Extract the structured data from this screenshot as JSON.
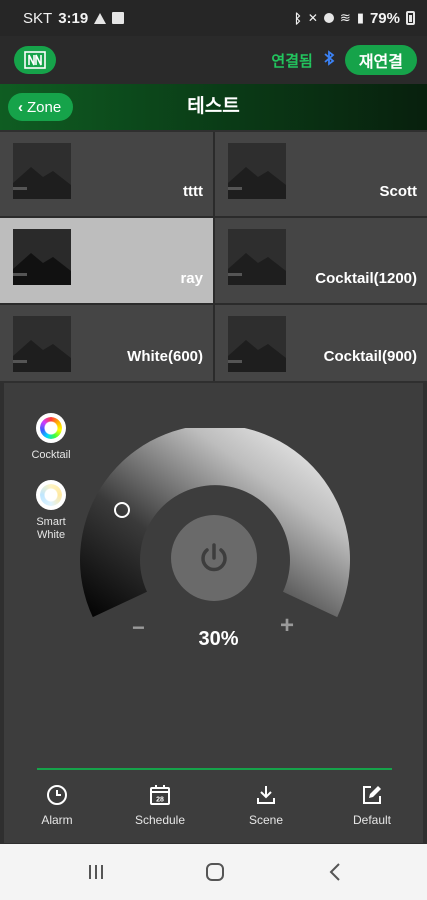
{
  "status_bar": {
    "carrier": "SKT",
    "time": "3:19",
    "battery": "79%"
  },
  "app_bar": {
    "connection_status": "연결됨",
    "bluetooth_icon": "bluetooth-icon",
    "reconnect_label": "재연결"
  },
  "header": {
    "back_label": "Zone",
    "title": "테스트"
  },
  "scenes": [
    {
      "label": "tttt",
      "selected": false
    },
    {
      "label": "Scott",
      "selected": false
    },
    {
      "label": "ray",
      "selected": true
    },
    {
      "label": "Cocktail(1200)",
      "selected": false
    },
    {
      "label": "White(600)",
      "selected": false
    },
    {
      "label": "Cocktail(900)",
      "selected": false
    }
  ],
  "modes": [
    {
      "label": "Cocktail",
      "icon": "color-wheel-icon"
    },
    {
      "label": "Smart\nWhite",
      "icon": "white-ring-icon"
    }
  ],
  "dimmer": {
    "level": "30%",
    "level_value": 0.3,
    "minus": "−",
    "plus": "+"
  },
  "tabs": [
    {
      "label": "Alarm",
      "icon": "clock-icon"
    },
    {
      "label": "Schedule",
      "icon": "calendar-icon",
      "badge": "28"
    },
    {
      "label": "Scene",
      "icon": "download-icon"
    },
    {
      "label": "Default",
      "icon": "edit-icon"
    }
  ],
  "colors": {
    "accent": "#16a34a",
    "bluetooth": "#3b82f6",
    "selected_tile": "#bdbdbd"
  }
}
